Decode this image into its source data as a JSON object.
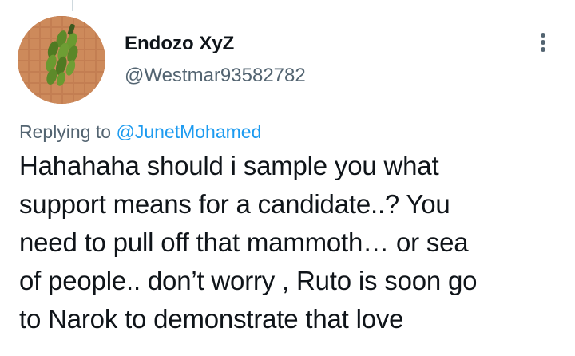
{
  "tweet": {
    "author": {
      "display_name": "Endozo XyZ",
      "handle": "@Westmar93582782",
      "avatar_icon": "banana-bunch-avatar"
    },
    "replying_to_prefix": "Replying to",
    "replying_to_handle": "@JunetMohamed",
    "text_lines": [
      "Hahahaha should i sample you what",
      "support means for a candidate..? You",
      "need to pull off that mammoth… or sea",
      "of people.. don’t worry , Ruto is soon go",
      "to Narok to demonstrate that love"
    ],
    "more_icon": "more-vertical-icon"
  },
  "colors": {
    "text_primary": "#0f1419",
    "text_secondary": "#536471",
    "link": "#1d9bf0",
    "thread_line": "#cfd9de"
  }
}
